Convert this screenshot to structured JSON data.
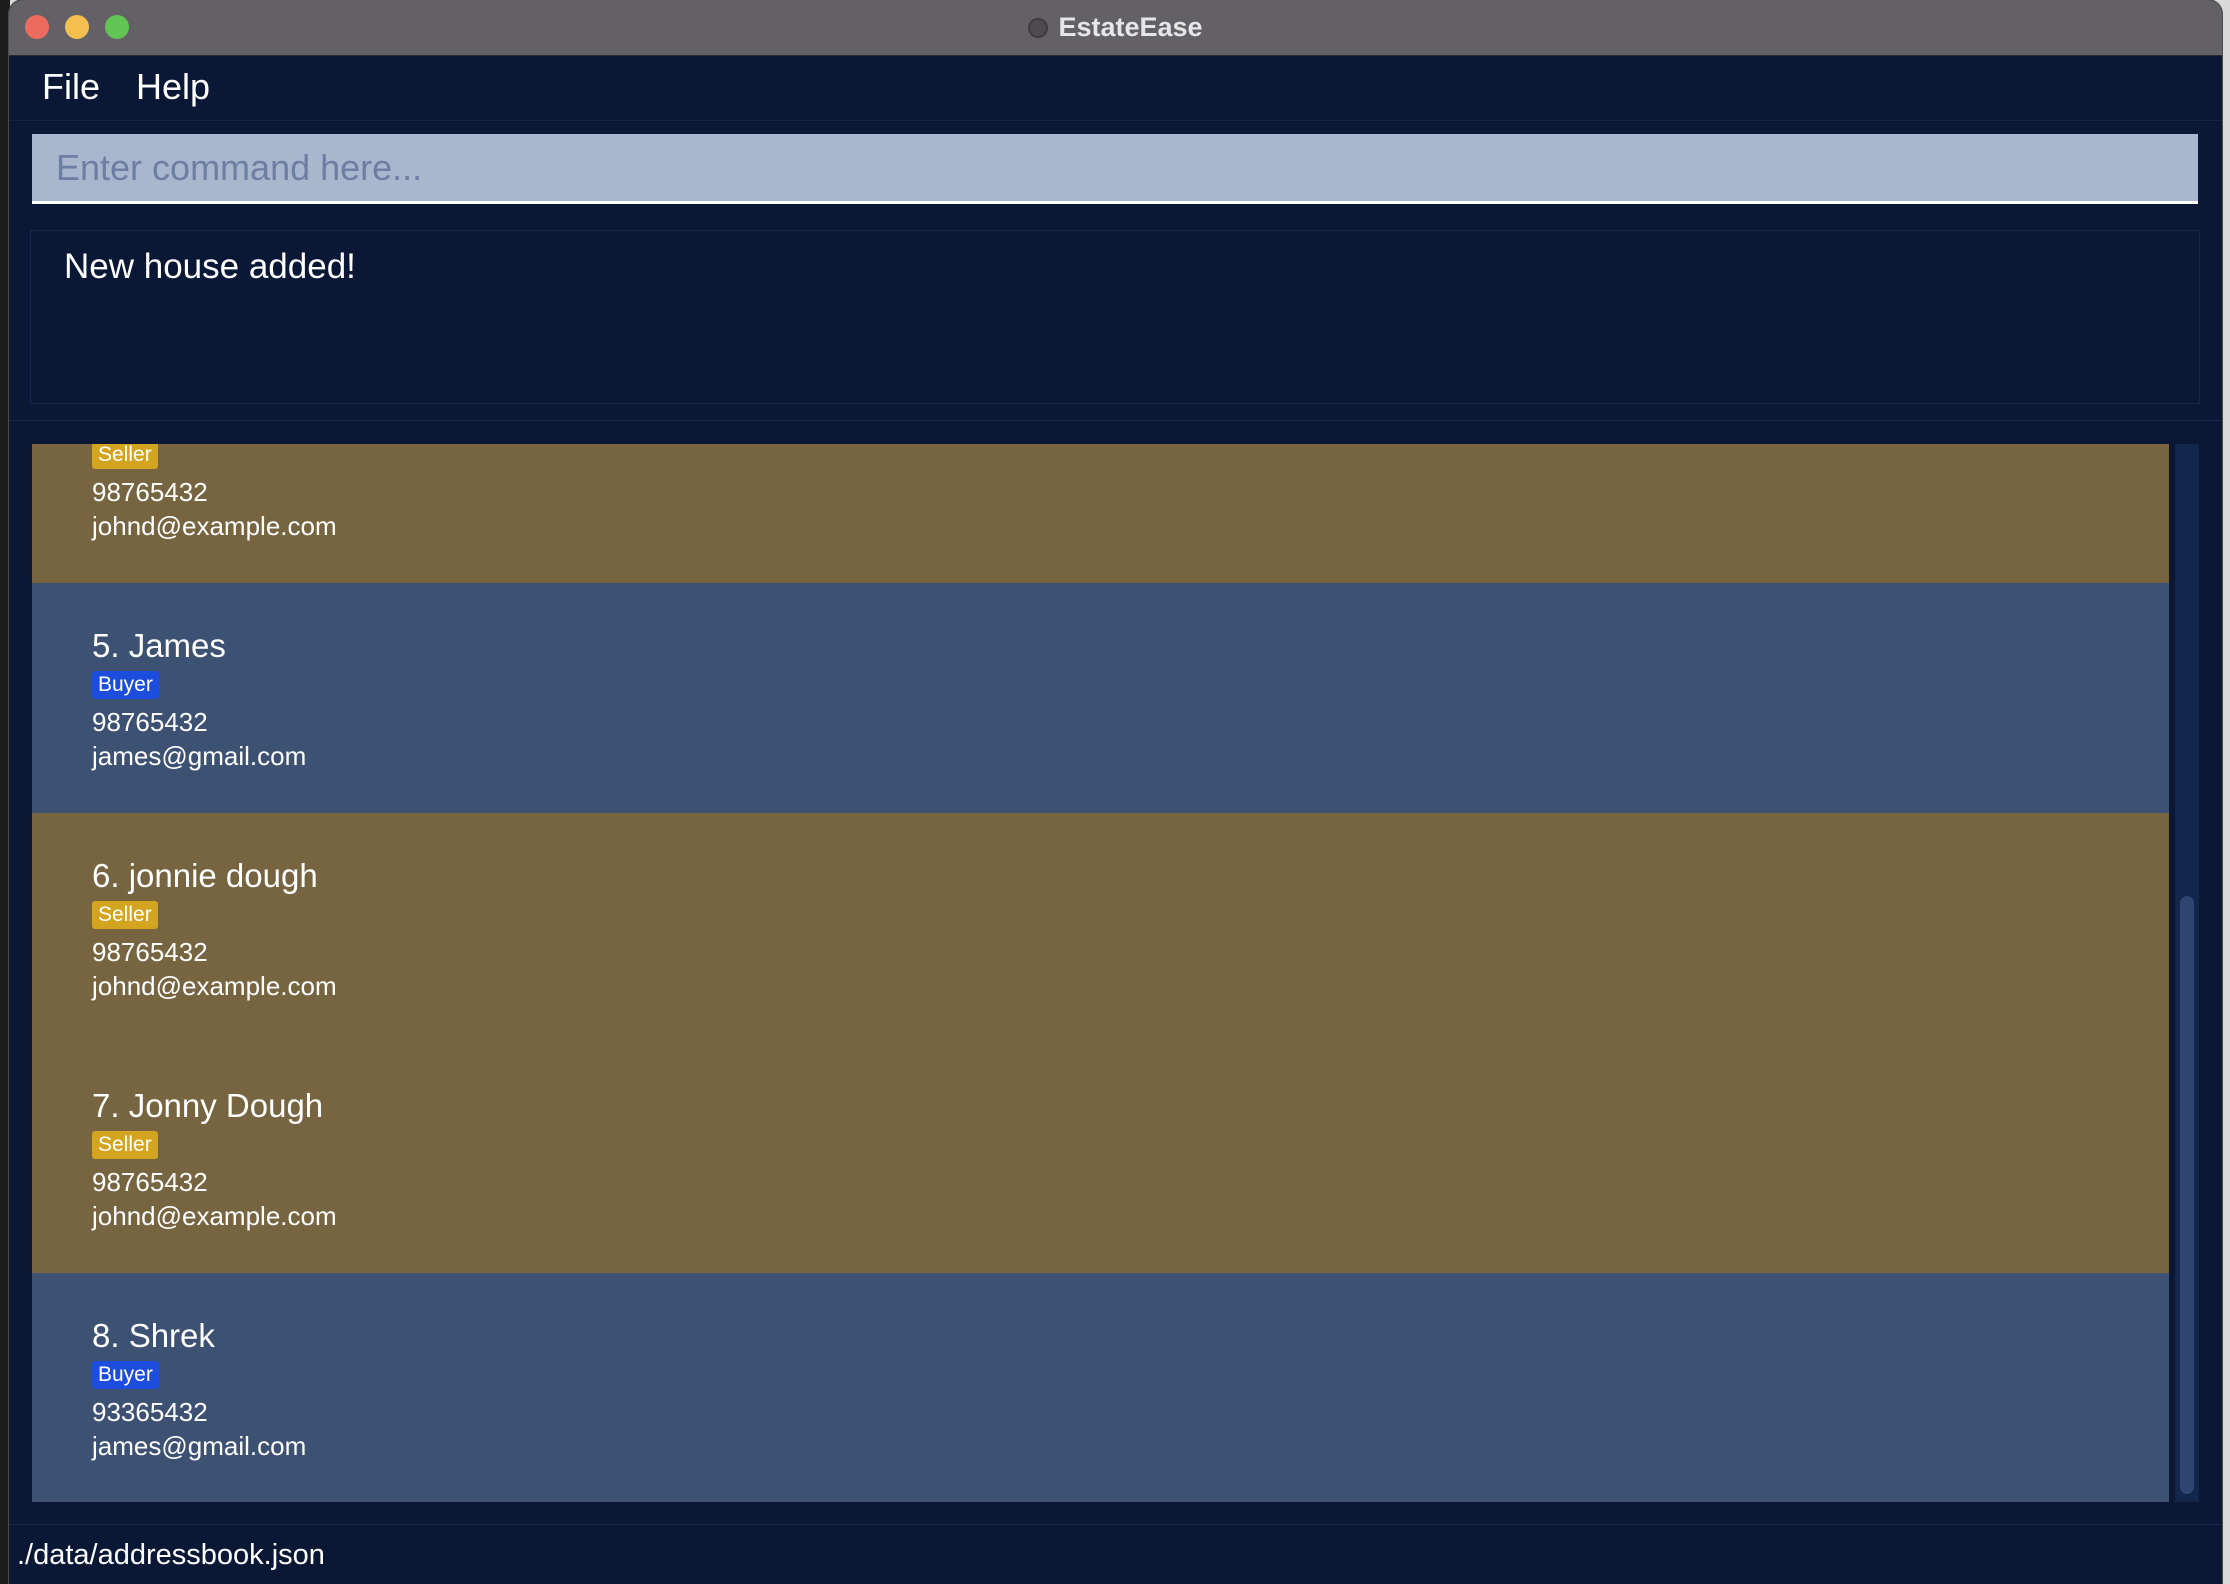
{
  "window": {
    "title": "EstateEase"
  },
  "menu": {
    "file": "File",
    "help": "Help"
  },
  "command": {
    "placeholder": "Enter command here...",
    "value": ""
  },
  "result": {
    "message": "New house added!"
  },
  "persons": [
    {
      "name": "",
      "tag": "Seller",
      "phone": "98765432",
      "email": "johnd@example.com"
    },
    {
      "name": "5.  James",
      "tag": "Buyer",
      "phone": "98765432",
      "email": "james@gmail.com"
    },
    {
      "name": "6.  jonnie dough",
      "tag": "Seller",
      "phone": "98765432",
      "email": "johnd@example.com"
    },
    {
      "name": "7.  Jonny Dough",
      "tag": "Seller",
      "phone": "98765432",
      "email": "johnd@example.com"
    },
    {
      "name": "8.  Shrek",
      "tag": "Buyer",
      "phone": "93365432",
      "email": "james@gmail.com"
    }
  ],
  "status": {
    "file_path": "./data/addressbook.json"
  },
  "colors": {
    "background": "#0b1835",
    "seller_card": "#766540",
    "buyer_card": "#3d5173",
    "seller_tag": "#d3a41f",
    "buyer_tag": "#1c4ddd",
    "command_box": "#a8b6ce"
  }
}
